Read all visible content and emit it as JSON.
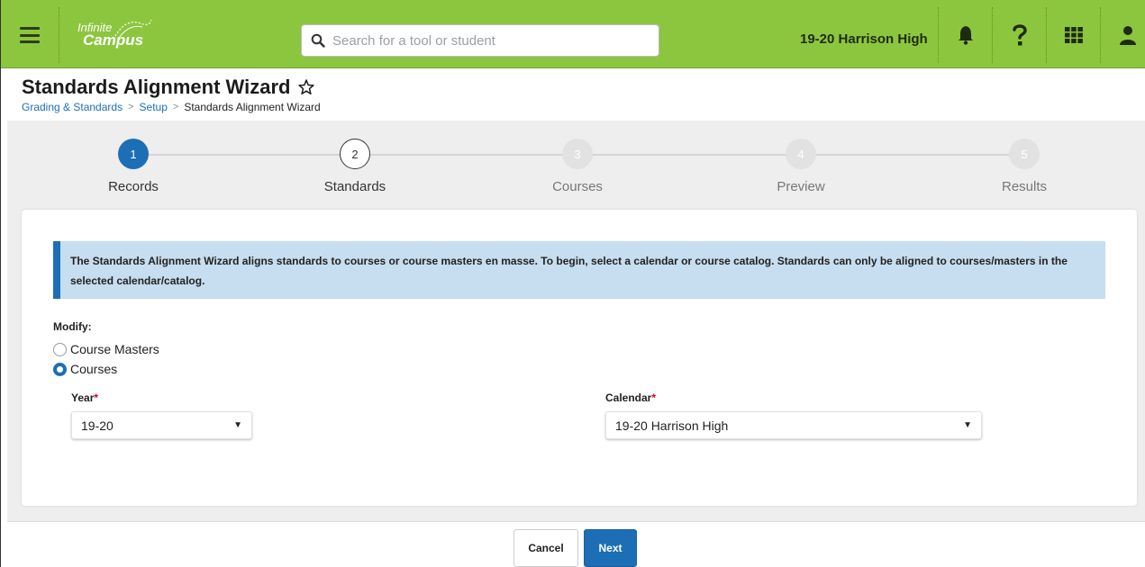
{
  "header": {
    "logo_line1": "Infinite",
    "logo_line2": "Campus",
    "search_placeholder": "Search for a tool or student",
    "school_name": "19-20 Harrison High",
    "icons": [
      "menu-icon",
      "search-icon",
      "bell-icon",
      "help-icon",
      "apps-grid-icon",
      "user-icon"
    ],
    "brand_color": "#8cc63f"
  },
  "page": {
    "title": "Standards Alignment Wizard",
    "breadcrumb": [
      "Grading & Standards",
      "Setup",
      "Standards Alignment Wizard"
    ]
  },
  "wizard": {
    "steps": [
      {
        "number": "1",
        "label": "Records",
        "state": "active"
      },
      {
        "number": "2",
        "label": "Standards",
        "state": "next"
      },
      {
        "number": "3",
        "label": "Courses",
        "state": "disabled"
      },
      {
        "number": "4",
        "label": "Preview",
        "state": "disabled"
      },
      {
        "number": "5",
        "label": "Results",
        "state": "disabled"
      }
    ],
    "accent_color": "#1c6fb5"
  },
  "form": {
    "info_text": "The Standards Alignment Wizard aligns standards to courses or course masters en masse. To begin, select a calendar or course catalog. Standards can only be aligned to courses/masters in the selected calendar/catalog.",
    "modify_label": "Modify:",
    "options": [
      {
        "label": "Course Masters",
        "selected": false
      },
      {
        "label": "Courses",
        "selected": true
      }
    ],
    "year_label": "Year",
    "year_value": "19-20",
    "calendar_label": "Calendar",
    "calendar_value": "19-20 Harrison High",
    "required_mark": "*"
  },
  "footer": {
    "cancel_label": "Cancel",
    "next_label": "Next"
  }
}
